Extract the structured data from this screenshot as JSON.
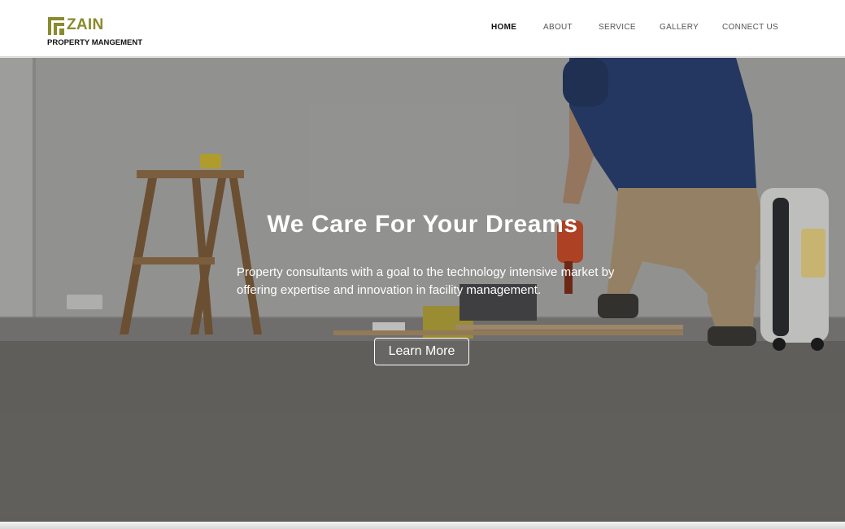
{
  "brand": {
    "name": "ZAIN",
    "tagline": "PROPERTY MANGEMENT",
    "accent_color": "#8a8a2e"
  },
  "nav": {
    "items": [
      {
        "label": "HOME",
        "active": true
      },
      {
        "label": "ABOUT"
      },
      {
        "label": "SERVICE"
      },
      {
        "label": "GALLERY"
      },
      {
        "label": "CONNECT US"
      }
    ]
  },
  "hero": {
    "title": "We Care For Your Dreams",
    "text": "Property consultants with a goal to the technology intensive market by offering expertise and innovation in facility management.",
    "button_label": "Learn More"
  }
}
